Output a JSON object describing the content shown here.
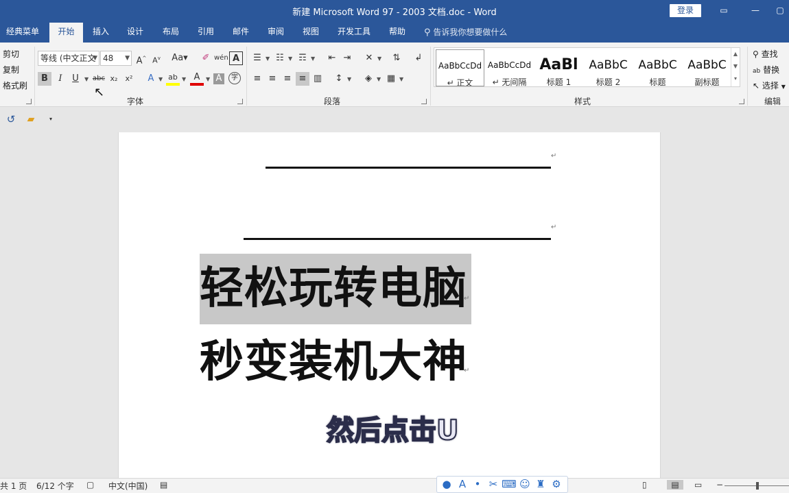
{
  "window": {
    "title": "新建 Microsoft Word 97 - 2003 文档.doc  -  Word",
    "login": "登录"
  },
  "tabs": [
    "经典菜单",
    "开始",
    "插入",
    "设计",
    "布局",
    "引用",
    "邮件",
    "审阅",
    "视图",
    "开发工具",
    "帮助"
  ],
  "tell_me": "告诉我你想要做什么",
  "clipboard": {
    "cut": "剪切",
    "copy": "复制",
    "format_painter": "格式刷"
  },
  "font": {
    "name": "等线 (中文正文",
    "size": "48",
    "group_label": "字体"
  },
  "paragraph": {
    "group_label": "段落"
  },
  "styles": {
    "group_label": "样式",
    "items": [
      {
        "sample": "AaBbCcDd",
        "name": "↵ 正文"
      },
      {
        "sample": "AaBbCcDd",
        "name": "↵ 无间隔"
      },
      {
        "sample": "AaBl",
        "name": "标题 1"
      },
      {
        "sample": "AaBbC",
        "name": "标题 2"
      },
      {
        "sample": "AaBbC",
        "name": "标题"
      },
      {
        "sample": "AaBbC",
        "name": "副标题"
      }
    ]
  },
  "editing": {
    "group_label": "编辑",
    "find": "查找",
    "replace": "替换",
    "select": "选择"
  },
  "document": {
    "line1": "轻松玩转电脑",
    "line2": "秒变装机大神",
    "pilcrow": "↵"
  },
  "subtitle": "然后点击U",
  "status": {
    "pages": "共 1 页",
    "words": "6/12 个字",
    "language": "中文(中国)"
  },
  "colors": {
    "brand": "#2b579a",
    "highlight": "#ffff00",
    "font_color": "#e00000"
  }
}
